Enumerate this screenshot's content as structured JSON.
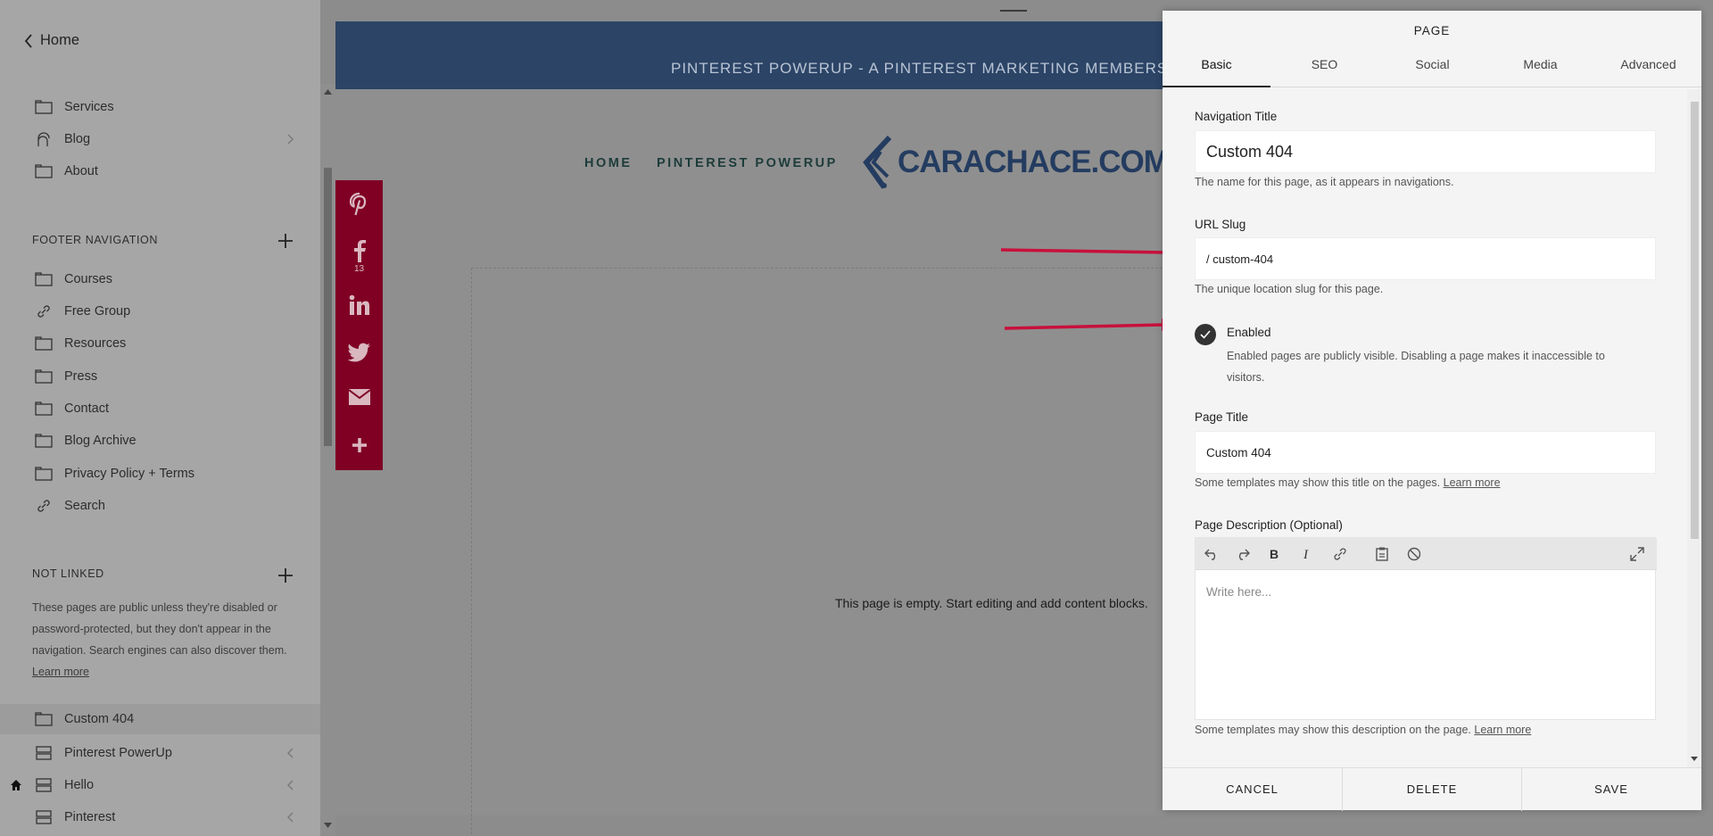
{
  "sidebar": {
    "back_label": "Home",
    "main_items": [
      {
        "label": "Services",
        "icon": "page-icon"
      },
      {
        "label": "Blog",
        "icon": "blog-icon"
      },
      {
        "label": "About",
        "icon": "page-icon"
      }
    ],
    "footer_title": "FOOTER NAVIGATION",
    "footer_items": [
      {
        "label": "Courses",
        "icon": "page-icon"
      },
      {
        "label": "Free Group",
        "icon": "link-icon"
      },
      {
        "label": "Resources",
        "icon": "page-icon"
      },
      {
        "label": "Press",
        "icon": "page-icon"
      },
      {
        "label": "Contact",
        "icon": "page-icon"
      },
      {
        "label": "Blog Archive",
        "icon": "page-icon"
      },
      {
        "label": "Privacy Policy + Terms",
        "icon": "page-icon"
      },
      {
        "label": "Search",
        "icon": "link-icon"
      }
    ],
    "not_linked_title": "NOT LINKED",
    "not_linked_note": "These pages are public unless they're disabled or password-protected, but they don't appear in the navigation. Search engines can also discover them.",
    "not_linked_learn_more": "Learn more",
    "not_linked_items": [
      {
        "label": "Custom 404",
        "icon": "page-icon",
        "active": true
      },
      {
        "label": "Pinterest PowerUp",
        "icon": "index-icon"
      },
      {
        "label": "Hello",
        "icon": "index-icon"
      },
      {
        "label": "Pinterest",
        "icon": "index-icon"
      }
    ]
  },
  "preview": {
    "banner_text": "PINTEREST POWERUP - A PINTEREST MARKETING MEMBERSHIP",
    "nav_home": "HOME",
    "nav_powerup": "PINTEREST POWERUP",
    "logo_text": "CARACHACE.COM",
    "empty_message": "This page is empty. Start editing and add content blocks.",
    "facebook_count": "13"
  },
  "panel": {
    "title": "PAGE",
    "tabs": [
      "Basic",
      "SEO",
      "Social",
      "Media",
      "Advanced"
    ],
    "active_tab": "Basic",
    "nav_title_label": "Navigation Title",
    "nav_title_value": "Custom 404",
    "nav_title_help": "The name for this page, as it appears in navigations.",
    "url_slug_label": "URL Slug",
    "url_slug_value": "/ custom-404",
    "url_slug_help": "The unique location slug for this page.",
    "enabled_label": "Enabled",
    "enabled_help": "Enabled pages are publicly visible. Disabling a page makes it inaccessible to visitors.",
    "page_title_label": "Page Title",
    "page_title_value": "Custom 404",
    "page_title_help": "Some templates may show this title on the pages.",
    "page_title_learn_more": "Learn more",
    "description_label": "Page Description (Optional)",
    "description_placeholder": "Write here...",
    "description_help": "Some templates may show this description on the page.",
    "description_learn_more": "Learn more",
    "cancel_label": "CANCEL",
    "delete_label": "DELETE",
    "save_label": "SAVE"
  },
  "colors": {
    "share_bar": "#800024",
    "banner": "#2c4466",
    "arrow": "#c8103c"
  }
}
